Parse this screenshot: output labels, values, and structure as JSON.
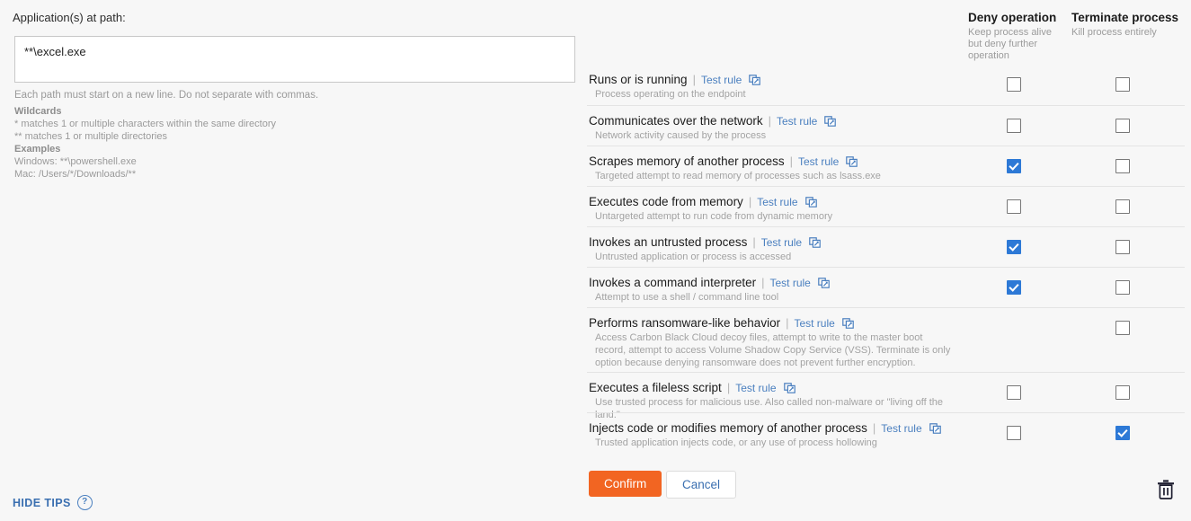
{
  "left": {
    "path_label": "Application(s) at path:",
    "path_value": "**\\excel.exe",
    "path_placeholder": "",
    "tips": {
      "note": "Each path must start on a new line. Do not separate with commas.",
      "wildcards_heading": "Wildcards",
      "wildcard_single": "* matches 1 or multiple characters within the same directory",
      "wildcard_double": "** matches 1 or multiple directories",
      "examples_heading": "Examples",
      "example_windows": "Windows: **\\powershell.exe",
      "example_mac": "Mac: /Users/*/Downloads/**"
    },
    "hide_tips_label": "HIDE TIPS",
    "help_icon_glyph": "?"
  },
  "columns": {
    "deny": {
      "title": "Deny operation",
      "subtitle": "Keep process alive but deny further operation"
    },
    "terminate": {
      "title": "Terminate process",
      "subtitle": "Kill process entirely"
    }
  },
  "test_rule_label": "Test rule",
  "separator": "|",
  "rules": [
    {
      "title": "Runs or is running",
      "desc": "Process operating on the endpoint",
      "deny": false,
      "deny_available": true,
      "terminate": false,
      "terminate_available": true
    },
    {
      "title": "Communicates over the network",
      "desc": "Network activity caused by the process",
      "deny": false,
      "deny_available": true,
      "terminate": false,
      "terminate_available": true
    },
    {
      "title": "Scrapes memory of another process",
      "desc": "Targeted attempt to read memory of processes such as lsass.exe",
      "deny": true,
      "deny_available": true,
      "terminate": false,
      "terminate_available": true
    },
    {
      "title": "Executes code from memory",
      "desc": "Untargeted attempt to run code from dynamic memory",
      "deny": false,
      "deny_available": true,
      "terminate": false,
      "terminate_available": true
    },
    {
      "title": "Invokes an untrusted process",
      "desc": "Untrusted application or process is accessed",
      "deny": true,
      "deny_available": true,
      "terminate": false,
      "terminate_available": true
    },
    {
      "title": "Invokes a command interpreter",
      "desc": "Attempt to use a shell / command line tool",
      "deny": true,
      "deny_available": true,
      "terminate": false,
      "terminate_available": true
    },
    {
      "title": "Performs ransomware-like behavior",
      "desc": "Access Carbon Black Cloud decoy files, attempt to write to the master boot record, attempt to access Volume Shadow Copy Service (VSS). Terminate is only option because denying ransomware does not prevent further encryption.",
      "deny": false,
      "deny_available": false,
      "terminate": false,
      "terminate_available": true
    },
    {
      "title": "Executes a fileless script",
      "desc": "Use trusted process for malicious use. Also called non-malware or \"living off the land.\"",
      "deny": false,
      "deny_available": true,
      "terminate": false,
      "terminate_available": true
    },
    {
      "title": "Injects code or modifies memory of another process",
      "desc": "Trusted application injects code, or any use of process hollowing",
      "deny": false,
      "deny_available": true,
      "terminate": true,
      "terminate_available": true
    }
  ],
  "footer": {
    "confirm_label": "Confirm",
    "cancel_label": "Cancel",
    "delete_icon": "trash-icon"
  },
  "colors": {
    "accent_orange": "#f26522",
    "link_blue": "#4a7fbf",
    "checkbox_blue": "#2d79d6",
    "page_bg": "#f7f7f7",
    "muted_text": "#9b9b9b"
  }
}
